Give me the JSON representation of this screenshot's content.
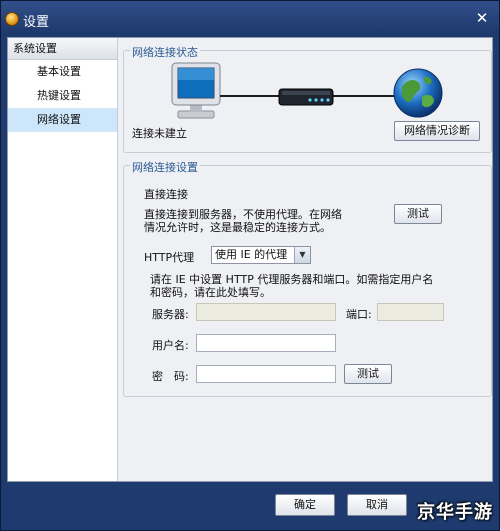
{
  "window": {
    "title": "设置"
  },
  "sidebar": {
    "header": "系统设置",
    "items": [
      {
        "label": "基本设置",
        "active": false
      },
      {
        "label": "热键设置",
        "active": false
      },
      {
        "label": "网络设置",
        "active": true
      }
    ]
  },
  "status_group": {
    "legend": "网络连接状态",
    "status_text": "连接未建立",
    "diagnose_button": "网络情况诊断"
  },
  "settings_group": {
    "legend": "网络连接设置",
    "direct_title": "直接连接",
    "direct_desc_line1": "直接连接到服务器，不使用代理。在网络",
    "direct_desc_line2": "情况允许时，这是最稳定的连接方式。",
    "direct_test_button": "测试",
    "http_proxy_label": "HTTP代理",
    "http_proxy_selected": "使用 IE 的代理",
    "note_line1": "请在 IE 中设置 HTTP 代理服务器和端口。如需指定用户名",
    "note_line2": "和密码，请在此处填写。",
    "server_label": "服务器:",
    "server_value": "",
    "port_label": "端口:",
    "port_value": "",
    "username_label": "用户名:",
    "username_value": "",
    "password_label": "密　码:",
    "password_value": "",
    "auth_test_button": "测试"
  },
  "footer": {
    "ok_button": "确定",
    "cancel_button": "取消"
  },
  "watermark": {
    "text": "京华手游"
  },
  "colors": {
    "title_bar": "#1c3768",
    "legend_text": "#2c5a96",
    "active_item": "#cde6f9",
    "panel_bg": "#eef0f3"
  },
  "icons": [
    "settings-app-icon",
    "close-icon",
    "computer-icon",
    "router-icon",
    "globe-icon",
    "dropdown-arrow-icon"
  ]
}
